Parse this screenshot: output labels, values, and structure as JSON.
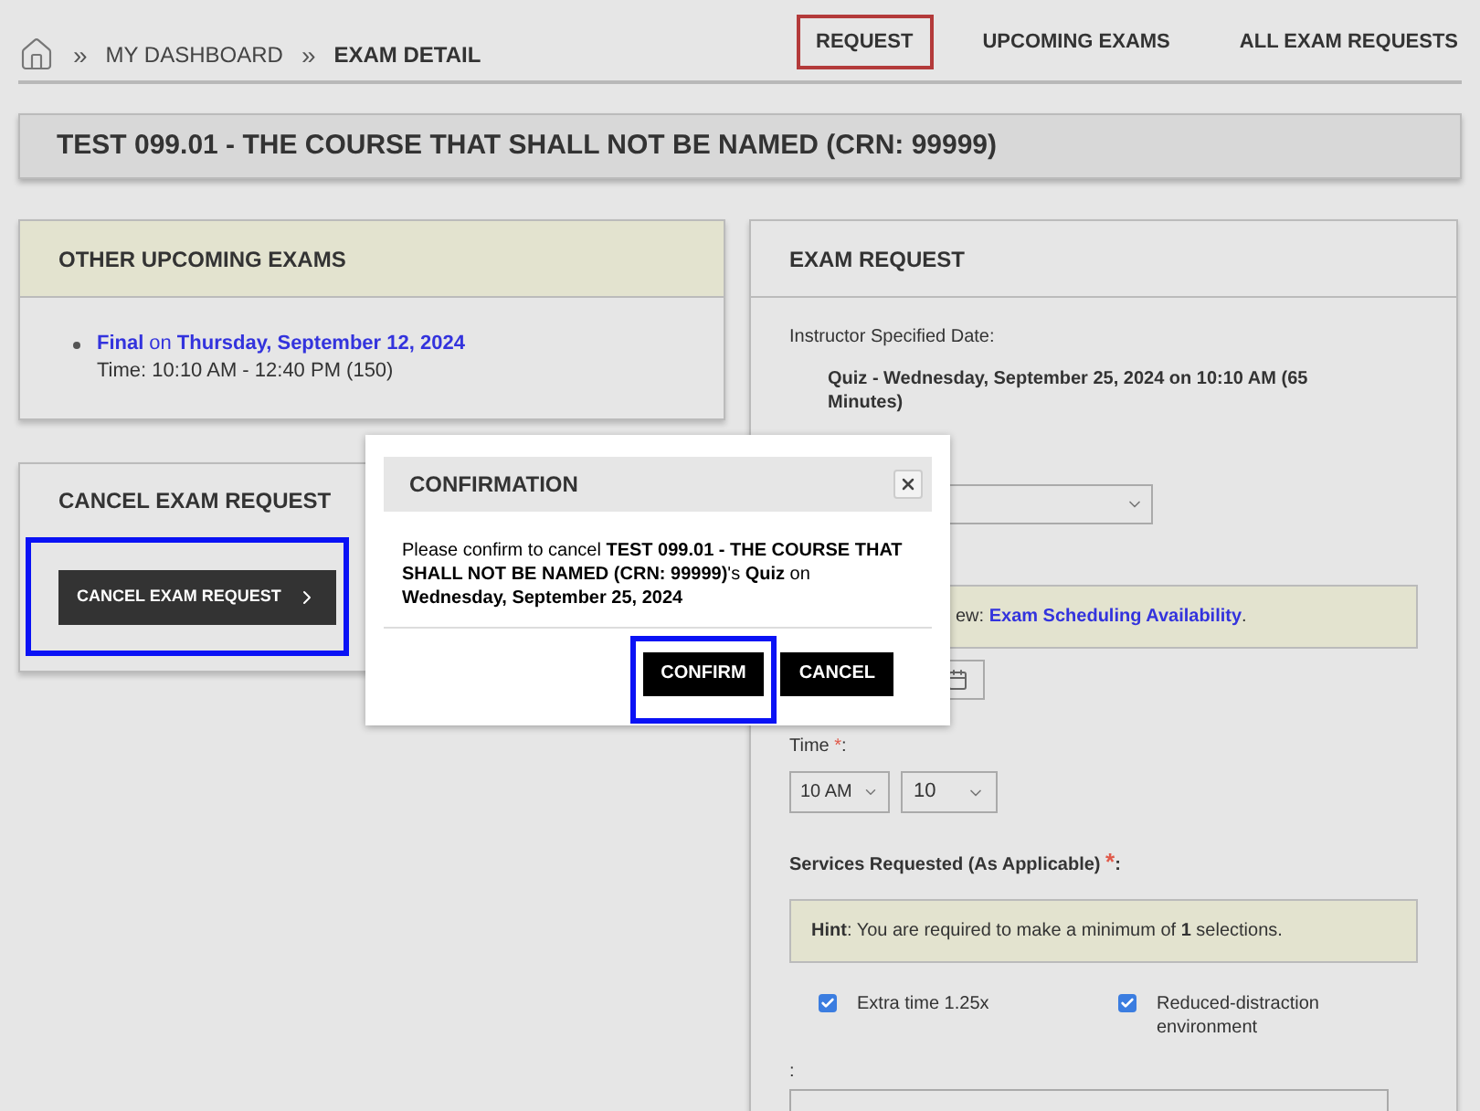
{
  "breadcrumb": {
    "separator": "»",
    "items": [
      {
        "label": "MY DASHBOARD",
        "current": false
      },
      {
        "label": "EXAM DETAIL",
        "current": true
      }
    ]
  },
  "nav": [
    {
      "label": "REQUEST",
      "selected": true
    },
    {
      "label": "UPCOMING EXAMS",
      "selected": false
    },
    {
      "label": "ALL EXAM REQUESTS",
      "selected": false
    }
  ],
  "course_title": "TEST 099.01 - THE COURSE THAT SHALL NOT BE NAMED (CRN: 99999)",
  "upcoming_exams": {
    "title": "OTHER UPCOMING EXAMS",
    "items": [
      {
        "name": "Final",
        "joiner": "on",
        "date": "Thursday, September 12, 2024",
        "time": "Time: 10:10 AM - 12:40 PM (150)"
      }
    ]
  },
  "cancel_card": {
    "title": "CANCEL EXAM REQUEST",
    "button": "CANCEL EXAM REQUEST",
    "highlighted": true
  },
  "exam_request": {
    "title": "EXAM REQUEST",
    "instructor_label": "Instructor Specified Date:",
    "instructor_date": "Quiz - Wednesday, September 25, 2024 on 10:10 AM (65 Minutes)",
    "availability": {
      "prefix": "ew: ",
      "link": "Exam Scheduling Availability",
      "suffix": "."
    },
    "time": {
      "label": "Time",
      "required_mark": "*",
      "suffix": ":",
      "hour": "10 AM",
      "minute": "10"
    },
    "services": {
      "label": "Services Requested (As Applicable)",
      "required_mark": "*",
      "suffix": ":",
      "hint": "**Hint**: You are required to make a minimum of **1** selections.",
      "options": [
        {
          "label": "Extra time 1.25x",
          "checked": true
        },
        {
          "label": "Reduced-distraction environment",
          "checked": true
        }
      ]
    },
    "notes_label": ":"
  },
  "dialog": {
    "title": "CONFIRMATION",
    "message": "Please confirm to cancel **TEST 099.01 - THE COURSE THAT SHALL NOT BE NAMED (CRN: 99999)**'s **Quiz** on **Wednesday, September 25, 2024**",
    "buttons": [
      {
        "label": "CONFIRM",
        "highlighted": true
      },
      {
        "label": "CANCEL",
        "highlighted": false
      }
    ]
  }
}
